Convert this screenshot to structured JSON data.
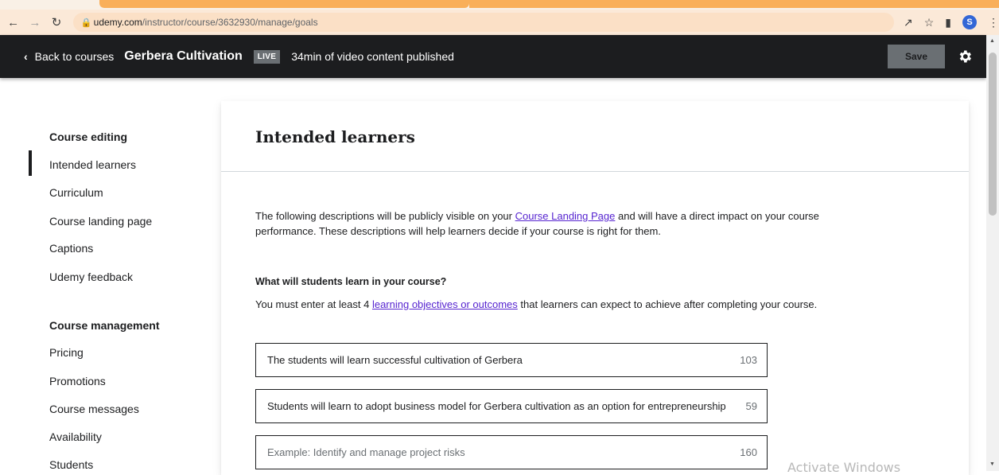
{
  "browser": {
    "url_host": "udemy.com",
    "url_path": "/instructor/course/3632930/manage/goals",
    "profile_initial": "S"
  },
  "topbar": {
    "back_label": "Back to courses",
    "course_title": "Gerbera Cultivation",
    "live_badge": "LIVE",
    "published_text": "34min of video content published",
    "save_label": "Save"
  },
  "sidebar": {
    "editing_heading": "Course editing",
    "editing_items": [
      {
        "label": "Intended learners",
        "active": true
      },
      {
        "label": "Curriculum"
      },
      {
        "label": "Course landing page"
      },
      {
        "label": "Captions"
      },
      {
        "label": "Udemy feedback"
      }
    ],
    "management_heading": "Course management",
    "management_items": [
      {
        "label": "Pricing"
      },
      {
        "label": "Promotions"
      },
      {
        "label": "Course messages"
      },
      {
        "label": "Availability"
      },
      {
        "label": "Students"
      }
    ]
  },
  "main": {
    "title": "Intended learners",
    "intro_before": "The following descriptions will be publicly visible on your ",
    "intro_link": "Course Landing Page",
    "intro_after": " and will have a direct impact on your course performance. These descriptions will help learners decide if your course is right for them.",
    "question_heading": "What will students learn in your course?",
    "question_before": "You must enter at least 4 ",
    "question_link": "learning objectives or outcomes",
    "question_after": " that learners can expect to achieve after completing your course.",
    "objectives": [
      {
        "value": "The students will learn successful cultivation of Gerbera",
        "remaining": "103"
      },
      {
        "value": "Students will learn to adopt business model for Gerbera cultivation as an option for entrepreneurship",
        "remaining": "59"
      },
      {
        "placeholder": "Example: Identify and manage project risks",
        "remaining": "160"
      }
    ]
  },
  "watermark": "Activate Windows"
}
